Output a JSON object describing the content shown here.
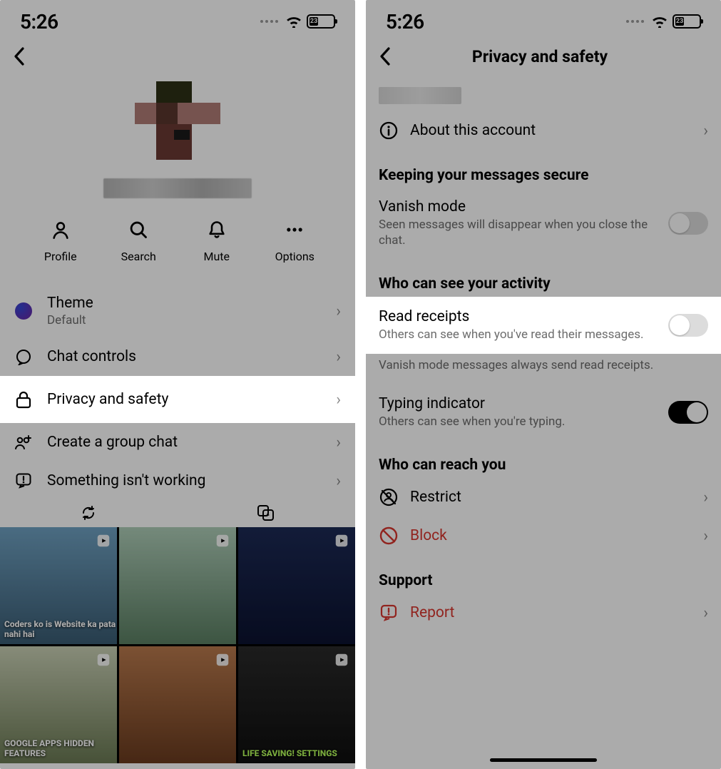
{
  "status": {
    "time": "5:26",
    "battery_pct": "23"
  },
  "left": {
    "quick_actions": {
      "profile": "Profile",
      "search": "Search",
      "mute": "Mute",
      "options": "Options"
    },
    "rows": {
      "theme": {
        "title": "Theme",
        "subtitle": "Default"
      },
      "chat_controls": "Chat controls",
      "privacy": "Privacy and safety",
      "group": "Create a group chat",
      "bug": "Something isn't working"
    },
    "tiles": {
      "t0": "Coders ko is Website ka pata nahi hai",
      "t4": "GOOGLE APPS HIDDEN FEATURES",
      "t6": "LIFE SAVING! SETTINGS"
    }
  },
  "right": {
    "title": "Privacy and safety",
    "about": "About this account",
    "section_secure": "Keeping your messages secure",
    "vanish": {
      "title": "Vanish mode",
      "sub": "Seen messages will disappear when you close the chat."
    },
    "section_activity": "Who can see your activity",
    "read": {
      "title": "Read receipts",
      "sub": "Others can see when you've read their messages."
    },
    "vanish_note": "Vanish mode messages always send read receipts.",
    "typing": {
      "title": "Typing indicator",
      "sub": "Others can see when you're typing."
    },
    "section_reach": "Who can reach you",
    "restrict": "Restrict",
    "block": "Block",
    "section_support": "Support",
    "report": "Report"
  }
}
